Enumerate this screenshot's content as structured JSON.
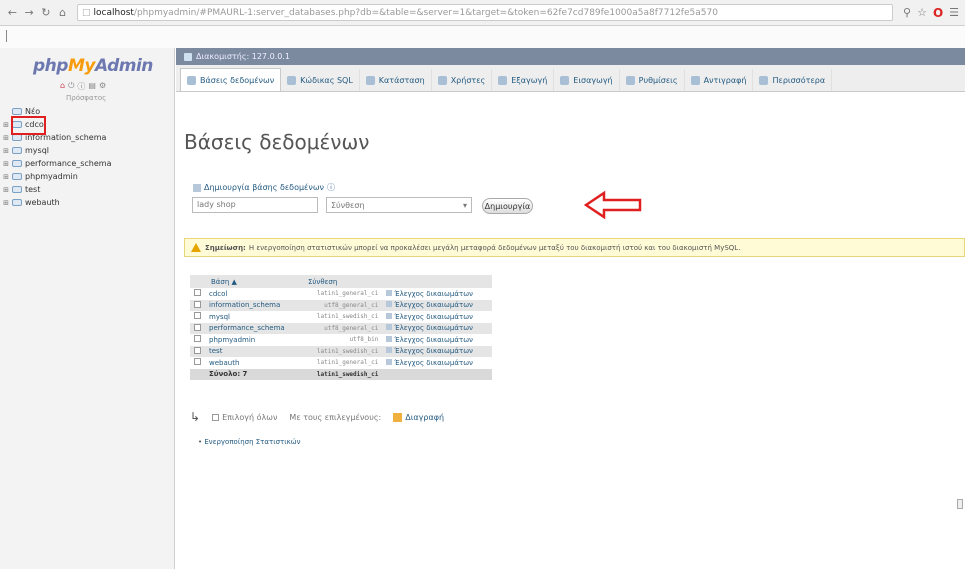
{
  "browser": {
    "url_host": "localhost",
    "url_rest": "/phpmyadmin/#PMAURL-1:server_databases.php?db=&table=&server=1&target=&token=62fe7cd789fe1000a5a8f7712fe5a570",
    "back_icon": "back-arrow-icon",
    "forward_icon": "forward-arrow-icon",
    "reload_icon": "reload-icon",
    "home_icon": "home-icon"
  },
  "sidebar": {
    "logo_php": "php",
    "logo_my": "My",
    "logo_admin": "Admin",
    "recent_label": "Πρόσφατος",
    "databases": [
      {
        "name": "Νέο",
        "is_new": true
      },
      {
        "name": "cdcol"
      },
      {
        "name": "information_schema"
      },
      {
        "name": "mysql"
      },
      {
        "name": "performance_schema"
      },
      {
        "name": "phpmyadmin"
      },
      {
        "name": "test"
      },
      {
        "name": "webauth"
      }
    ]
  },
  "main": {
    "server_crumb": "Διακομιστής: 127.0.0.1",
    "tabs": [
      {
        "label": "Βάσεις δεδομένων",
        "active": true
      },
      {
        "label": "Κώδικας SQL"
      },
      {
        "label": "Κατάσταση"
      },
      {
        "label": "Χρήστες"
      },
      {
        "label": "Εξαγωγή"
      },
      {
        "label": "Εισαγωγή"
      },
      {
        "label": "Ρυθμίσεις"
      },
      {
        "label": "Αντιγραφή"
      },
      {
        "label": "Περισσότερα"
      }
    ],
    "page_title": "Βάσεις δεδομένων",
    "create": {
      "label": "Δημιουργία βάσης δεδομένων",
      "input_value": "lady shop",
      "collation_value": "Σύνθεση",
      "button_label": "Δημιουργία"
    },
    "notice": {
      "title": "Σημείωση:",
      "text": "Η ενεργοποίηση στατιστικών μπορεί να προκαλέσει μεγάλη μεταφορά δεδομένων μεταξύ του διακομιστή ιστού και του διακομιστή MySQL."
    },
    "table": {
      "headers": [
        "Βάση",
        "Σύνθεση"
      ],
      "sort_marker": "▲",
      "rows": [
        {
          "name": "cdcol",
          "collation": "latin1_general_ci",
          "priv": "Έλεγχος δικαιωμάτων"
        },
        {
          "name": "information_schema",
          "collation": "utf8_general_ci",
          "priv": "Έλεγχος δικαιωμάτων"
        },
        {
          "name": "mysql",
          "collation": "latin1_swedish_ci",
          "priv": "Έλεγχος δικαιωμάτων"
        },
        {
          "name": "performance_schema",
          "collation": "utf8_general_ci",
          "priv": "Έλεγχος δικαιωμάτων"
        },
        {
          "name": "phpmyadmin",
          "collation": "utf8_bin",
          "priv": "Έλεγχος δικαιωμάτων"
        },
        {
          "name": "test",
          "collation": "latin1_swedish_ci",
          "priv": "Έλεγχος δικαιωμάτων"
        },
        {
          "name": "webauth",
          "collation": "latin1_general_ci",
          "priv": "Έλεγχος δικαιωμάτων"
        }
      ],
      "total_label": "Σύνολο: 7",
      "total_collation": "latin1_swedish_ci"
    },
    "bulk": {
      "select_all": "Επιλογή όλων",
      "with_selected": "Με τους επιλεγμένους:",
      "drop": "Διαγραφή"
    },
    "stats_link": "Ενεργοποίηση Στατιστικών"
  },
  "colors": {
    "brand_php": "#6c78af",
    "brand_my": "#f89c0e",
    "link": "#235a81",
    "annotation_red": "#e02020"
  }
}
